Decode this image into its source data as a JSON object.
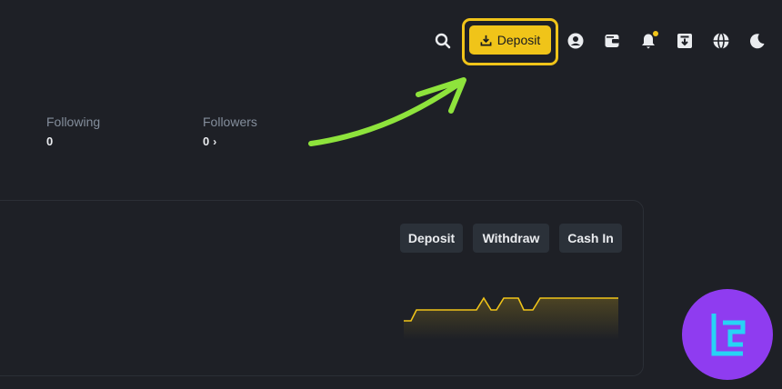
{
  "header": {
    "icons": [
      "search-icon",
      "user-icon",
      "wallet-icon",
      "bell-icon",
      "download-icon",
      "globe-icon",
      "moon-icon"
    ],
    "deposit_label": "Deposit",
    "accent": "#f0c419"
  },
  "profile": {
    "following_label": "Following",
    "following_value": "0",
    "followers_label": "Followers",
    "followers_value": "0"
  },
  "wallet_card": {
    "buttons": [
      "Deposit",
      "Withdraw",
      "Cash In"
    ]
  },
  "annotation": {
    "arrow_color": "#8ee33c",
    "highlight_color": "#f0c419"
  },
  "watermark": {
    "logo_color": "#8f3cf0",
    "logo_text": "TC"
  }
}
